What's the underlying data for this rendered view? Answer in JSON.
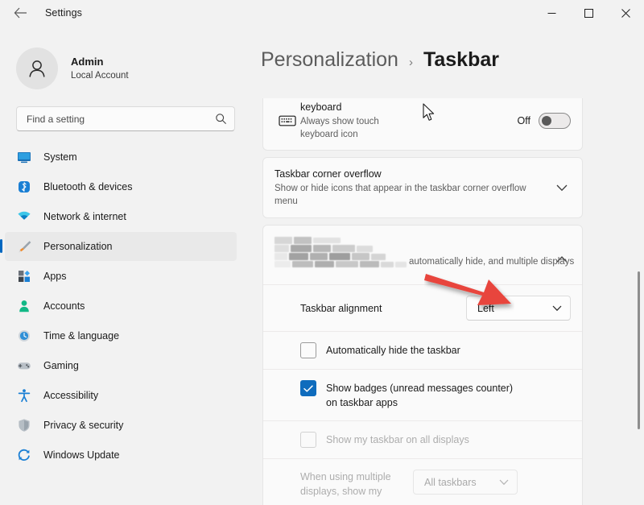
{
  "window": {
    "title": "Settings",
    "back_label": "Back",
    "minimize_label": "Minimize",
    "maximize_label": "Maximize",
    "close_label": "Close"
  },
  "account": {
    "name": "Admin",
    "subtitle": "Local Account",
    "avatar_icon": "person-icon"
  },
  "search": {
    "placeholder": "Find a setting",
    "icon": "search-icon"
  },
  "sidebar": {
    "items": [
      {
        "label": "System",
        "icon": "monitor-icon",
        "selected": false
      },
      {
        "label": "Bluetooth & devices",
        "icon": "bluetooth-icon",
        "selected": false
      },
      {
        "label": "Network & internet",
        "icon": "wifi-icon",
        "selected": false
      },
      {
        "label": "Personalization",
        "icon": "paintbrush-icon",
        "selected": true
      },
      {
        "label": "Apps",
        "icon": "apps-icon",
        "selected": false
      },
      {
        "label": "Accounts",
        "icon": "account-icon",
        "selected": false
      },
      {
        "label": "Time & language",
        "icon": "clock-icon",
        "selected": false
      },
      {
        "label": "Gaming",
        "icon": "gamepad-icon",
        "selected": false
      },
      {
        "label": "Accessibility",
        "icon": "accessibility-icon",
        "selected": false
      },
      {
        "label": "Privacy & security",
        "icon": "shield-icon",
        "selected": false
      },
      {
        "label": "Windows Update",
        "icon": "update-icon",
        "selected": false
      }
    ]
  },
  "breadcrumb": {
    "parent": "Personalization",
    "separator": "›",
    "current": "Taskbar"
  },
  "settings": {
    "keyboard_card": {
      "icon": "keyboard-icon",
      "title": "keyboard",
      "subtitle": "Always show touch keyboard icon",
      "toggle_label": "Off",
      "toggle_state": "off"
    },
    "corner_overflow_card": {
      "title": "Taskbar corner overflow",
      "subtitle": "Show or hide icons that appear in the taskbar corner overflow menu",
      "expander_icon": "chevron-down-icon",
      "expanded": false
    },
    "behaviors_card": {
      "title_redacted": true,
      "title_visible_tail": "automatically hide, and multiple displays",
      "expander_icon": "chevron-up-icon",
      "expanded": true,
      "rows": {
        "alignment": {
          "label": "Taskbar alignment",
          "value": "Left",
          "chevron_icon": "chevron-down-icon",
          "disabled": false
        },
        "auto_hide": {
          "label": "Automatically hide the taskbar",
          "checked": false,
          "disabled": false
        },
        "badges": {
          "label": "Show badges (unread messages counter) on taskbar apps",
          "checked": true,
          "disabled": false
        },
        "all_displays": {
          "label": "Show my taskbar on all displays",
          "checked": false,
          "disabled": true
        },
        "multi_display": {
          "label": "When using multiple displays, show my",
          "value": "All taskbars",
          "chevron_icon": "chevron-down-icon",
          "disabled": true
        }
      }
    }
  },
  "annotation": {
    "arrow_color": "#e8453c",
    "arrow_direction": "down-right"
  },
  "colors": {
    "page_background": "#f2f2f2",
    "card_background": "#fafafa",
    "accent": "#0067c0",
    "checkbox_checked": "#0f6cbd"
  }
}
